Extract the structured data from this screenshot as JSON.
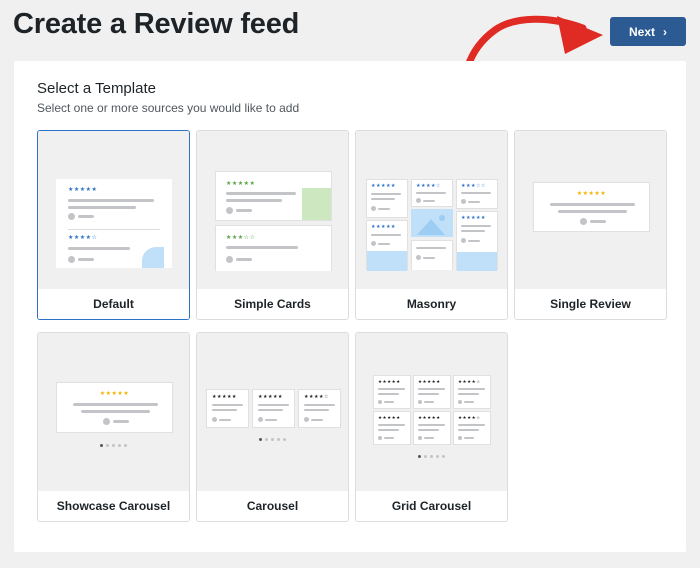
{
  "page": {
    "title": "Create a Review feed",
    "next_label": "Next"
  },
  "template_section": {
    "title": "Select a Template",
    "subtitle": "Select one or more sources you would like to add"
  },
  "templates": [
    {
      "label": "Default",
      "selected": true
    },
    {
      "label": "Simple Cards",
      "selected": false
    },
    {
      "label": "Masonry",
      "selected": false
    },
    {
      "label": "Single Review",
      "selected": false
    },
    {
      "label": "Showcase Carousel",
      "selected": false
    },
    {
      "label": "Carousel",
      "selected": false
    },
    {
      "label": "Grid Carousel",
      "selected": false
    }
  ],
  "colors": {
    "primary_button": "#2c5a93",
    "selected_border": "#2c72c6",
    "arrow": "#e02a24",
    "star_blue": "#2c72c6",
    "star_green": "#5ba342",
    "star_gold": "#f0b400",
    "star_dark": "#1d2327"
  },
  "icons": {
    "next": "chevron-right-icon",
    "annotation": "curved-arrow-icon"
  }
}
